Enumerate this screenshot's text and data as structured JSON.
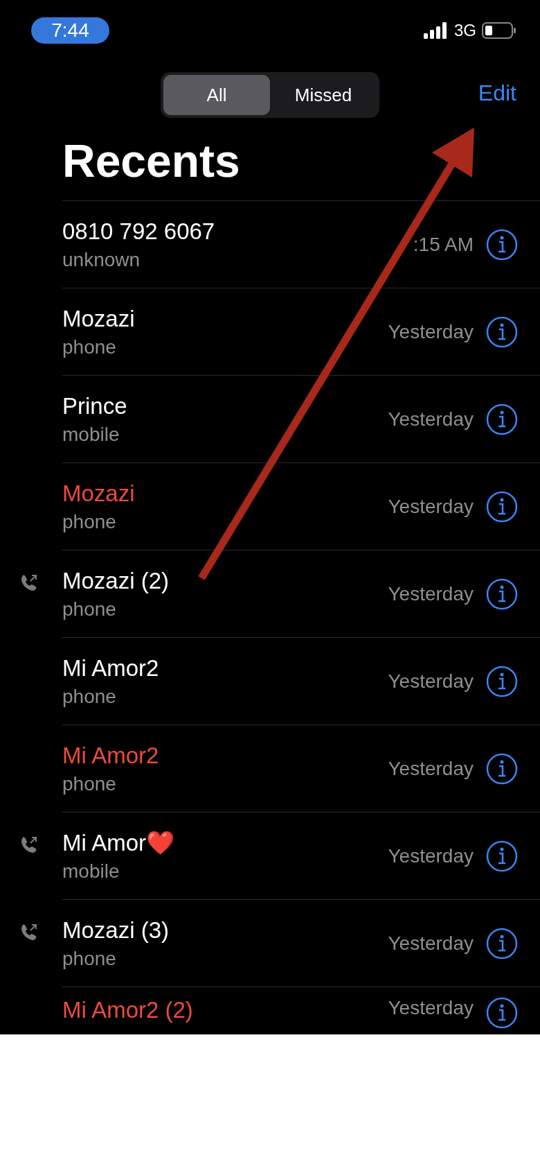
{
  "status_bar": {
    "time": "7:44",
    "network": "3G"
  },
  "segments": [
    {
      "label": "All",
      "selected": true
    },
    {
      "label": "Missed",
      "selected": false
    }
  ],
  "edit_button": "Edit",
  "title": "Recents",
  "calls": [
    {
      "name": "0810 792 6067",
      "type": "unknown",
      "time": ":15 AM",
      "missed": false,
      "outgoing": false
    },
    {
      "name": "Mozazi",
      "type": "phone",
      "time": "Yesterday",
      "missed": false,
      "outgoing": false
    },
    {
      "name": "Prince",
      "type": "mobile",
      "time": "Yesterday",
      "missed": false,
      "outgoing": false
    },
    {
      "name": "Mozazi",
      "type": "phone",
      "time": "Yesterday",
      "missed": true,
      "outgoing": false
    },
    {
      "name": "Mozazi (2)",
      "type": "phone",
      "time": "Yesterday",
      "missed": false,
      "outgoing": true
    },
    {
      "name": "Mi Amor2",
      "type": "phone",
      "time": "Yesterday",
      "missed": false,
      "outgoing": false
    },
    {
      "name": "Mi Amor2",
      "type": "phone",
      "time": "Yesterday",
      "missed": true,
      "outgoing": false
    },
    {
      "name": "Mi Amor❤️",
      "type": "mobile",
      "time": "Yesterday",
      "missed": false,
      "outgoing": true
    },
    {
      "name": "Mozazi (3)",
      "type": "phone",
      "time": "Yesterday",
      "missed": false,
      "outgoing": true
    },
    {
      "name": "Mi Amor2 (2)",
      "time": "Yesterday",
      "missed": true,
      "outgoing": false
    }
  ]
}
